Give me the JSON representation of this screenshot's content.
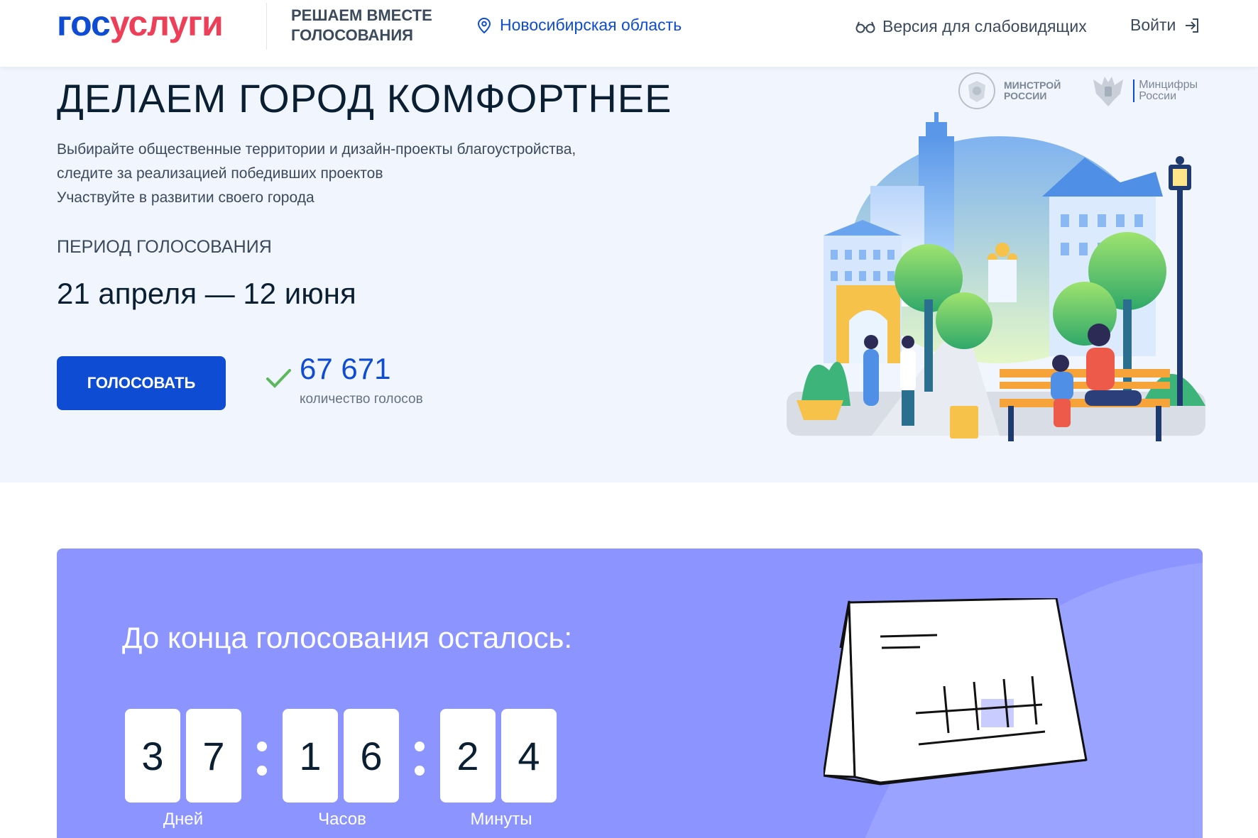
{
  "header": {
    "logo_part1": "гос",
    "logo_part2": "услуги",
    "project_title_line1": "Решаем вместе",
    "project_title_line2": "голосования",
    "region": "Новосибирская область",
    "vision_label": "Версия для слабовидящих",
    "login_label": "Войти"
  },
  "hero": {
    "title": "ДЕЛАЕМ ГОРОД КОМФОРТНЕЕ",
    "description": [
      "Выбирайте общественные территории и дизайн-проекты благоустройства,",
      "следите за реализацией победивших проектов",
      "Участвуйте в развитии своего города"
    ],
    "period_label": "Период голосования",
    "period_value": "21 апреля — 12 июня",
    "vote_button": "Голосовать",
    "votes_count": "67 671",
    "votes_label": "количество голосов",
    "logos": [
      {
        "line1": "Минстрой",
        "line2": "России"
      },
      {
        "line1": "Минцифры",
        "line2": "России"
      }
    ]
  },
  "countdown": {
    "title": "До конца голосования осталось:",
    "days": [
      "3",
      "7"
    ],
    "hours": [
      "1",
      "6"
    ],
    "minutes": [
      "2",
      "4"
    ],
    "labels": {
      "days": "Дней",
      "hours": "Часов",
      "minutes": "Минуты"
    }
  },
  "colors": {
    "brand_blue": "#0d4cd3",
    "brand_red": "#ee3f58",
    "hero_bg": "#f1f5fd",
    "countdown_bg": "#8c95ff"
  }
}
